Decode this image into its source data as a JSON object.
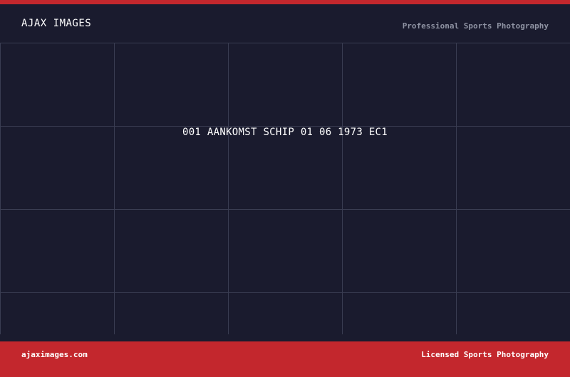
{
  "header": {
    "brand": "AJAX IMAGES",
    "tagline": "Professional Sports Photography"
  },
  "main": {
    "photo_title": "001 AANKOMST SCHIP 01 06 1973 EC1"
  },
  "footer": {
    "website": "ajaximages.com",
    "license": "Licensed Sports Photography"
  },
  "colors": {
    "background": "#1a1b2e",
    "accent": "#c3272d",
    "grid_line": "#3a3d52",
    "text_primary": "#ffffff",
    "text_muted": "#8f93a3"
  }
}
